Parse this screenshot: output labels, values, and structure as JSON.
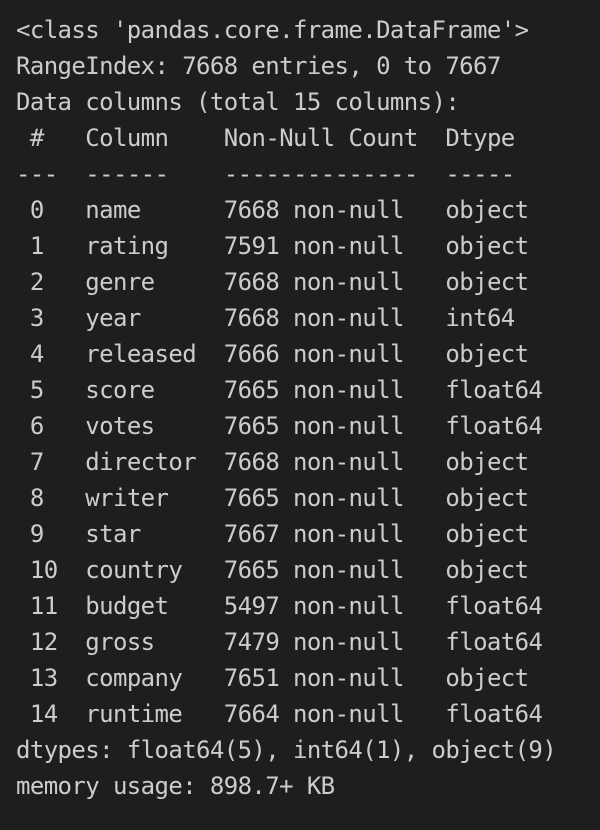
{
  "output": {
    "class_line": "<class 'pandas.core.frame.DataFrame'>",
    "range_index": "RangeIndex: 7668 entries, 0 to 7667",
    "columns_header": "Data columns (total 15 columns):",
    "table_header": {
      "num": "#",
      "column": "Column",
      "non_null": "Non-Null Count",
      "dtype": "Dtype"
    },
    "separators": {
      "num": "---",
      "column": "------",
      "non_null": "--------------",
      "dtype": "-----"
    },
    "rows": [
      {
        "num": "0",
        "column": "name",
        "non_null": "7668 non-null",
        "dtype": "object"
      },
      {
        "num": "1",
        "column": "rating",
        "non_null": "7591 non-null",
        "dtype": "object"
      },
      {
        "num": "2",
        "column": "genre",
        "non_null": "7668 non-null",
        "dtype": "object"
      },
      {
        "num": "3",
        "column": "year",
        "non_null": "7668 non-null",
        "dtype": "int64"
      },
      {
        "num": "4",
        "column": "released",
        "non_null": "7666 non-null",
        "dtype": "object"
      },
      {
        "num": "5",
        "column": "score",
        "non_null": "7665 non-null",
        "dtype": "float64"
      },
      {
        "num": "6",
        "column": "votes",
        "non_null": "7665 non-null",
        "dtype": "float64"
      },
      {
        "num": "7",
        "column": "director",
        "non_null": "7668 non-null",
        "dtype": "object"
      },
      {
        "num": "8",
        "column": "writer",
        "non_null": "7665 non-null",
        "dtype": "object"
      },
      {
        "num": "9",
        "column": "star",
        "non_null": "7667 non-null",
        "dtype": "object"
      },
      {
        "num": "10",
        "column": "country",
        "non_null": "7665 non-null",
        "dtype": "object"
      },
      {
        "num": "11",
        "column": "budget",
        "non_null": "5497 non-null",
        "dtype": "float64"
      },
      {
        "num": "12",
        "column": "gross",
        "non_null": "7479 non-null",
        "dtype": "float64"
      },
      {
        "num": "13",
        "column": "company",
        "non_null": "7651 non-null",
        "dtype": "object"
      },
      {
        "num": "14",
        "column": "runtime",
        "non_null": "7664 non-null",
        "dtype": "float64"
      }
    ],
    "dtypes_line": "dtypes: float64(5), int64(1), object(9)",
    "memory_line": "memory usage: 898.7+ KB"
  }
}
